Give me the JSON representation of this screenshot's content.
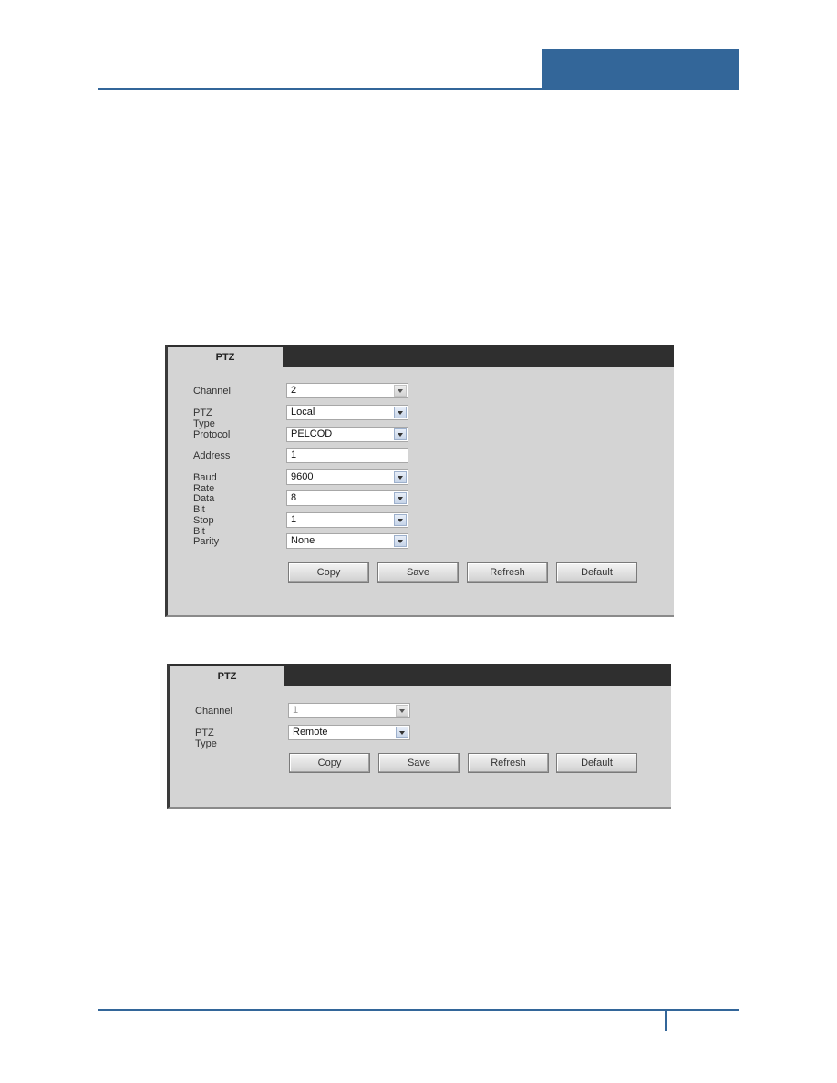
{
  "page": {
    "header_accent_color": "#336699"
  },
  "panel1": {
    "tab_label": "PTZ",
    "fields": [
      {
        "label": "Channel",
        "value": "2",
        "type": "select",
        "enabled": false
      },
      {
        "label": "PTZ Type",
        "value": "Local",
        "type": "select",
        "enabled": true
      },
      {
        "label": "Protocol",
        "value": "PELCOD",
        "type": "select",
        "enabled": true
      },
      {
        "label": "Address",
        "value": "1",
        "type": "text",
        "enabled": true
      },
      {
        "label": "Baud Rate",
        "value": "9600",
        "type": "select",
        "enabled": true
      },
      {
        "label": "Data Bit",
        "value": "8",
        "type": "select",
        "enabled": true
      },
      {
        "label": "Stop Bit",
        "value": "1",
        "type": "select",
        "enabled": true
      },
      {
        "label": "Parity",
        "value": "None",
        "type": "select",
        "enabled": true
      }
    ],
    "buttons": [
      "Copy",
      "Save",
      "Refresh",
      "Default"
    ]
  },
  "panel2": {
    "tab_label": "PTZ",
    "fields": [
      {
        "label": "Channel",
        "value": "1",
        "type": "select",
        "enabled": false
      },
      {
        "label": "PTZ Type",
        "value": "Remote",
        "type": "select",
        "enabled": true
      }
    ],
    "buttons": [
      "Copy",
      "Save",
      "Refresh",
      "Default"
    ]
  }
}
